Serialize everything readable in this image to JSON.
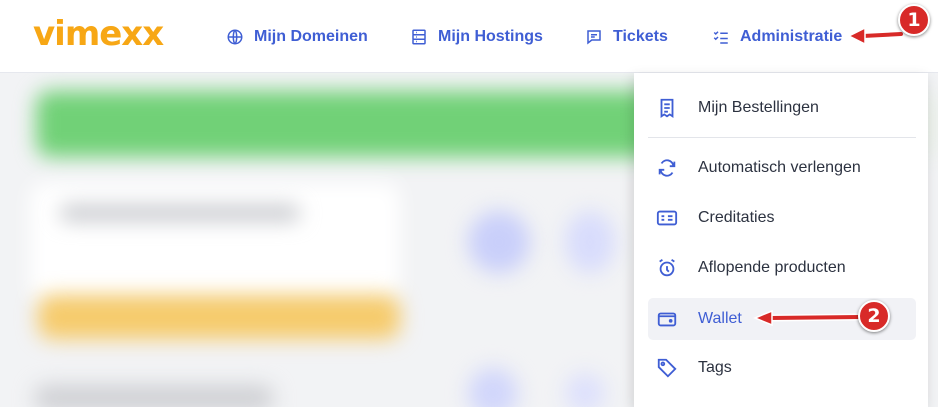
{
  "header": {
    "logo_text": "vimexx",
    "nav": [
      {
        "label": "Mijn Domeinen",
        "icon": "globe-icon"
      },
      {
        "label": "Mijn Hostings",
        "icon": "server-icon"
      },
      {
        "label": "Tickets",
        "icon": "chat-icon"
      },
      {
        "label": "Administratie",
        "icon": "checklist-icon"
      }
    ]
  },
  "dropdown": {
    "items": [
      {
        "label": "Mijn Bestellingen",
        "icon": "receipt-icon"
      },
      {
        "label": "Automatisch verlengen",
        "icon": "refresh-icon"
      },
      {
        "label": "Creditaties",
        "icon": "credit-icon"
      },
      {
        "label": "Aflopende producten",
        "icon": "alarm-icon"
      },
      {
        "label": "Wallet",
        "icon": "wallet-icon",
        "active": true
      },
      {
        "label": "Tags",
        "icon": "tag-icon"
      }
    ]
  },
  "annotations": {
    "step1": "1",
    "step2": "2"
  },
  "colors": {
    "accent": "#3f5ed4",
    "logo": "#f7a715",
    "annotation": "#d82a28"
  }
}
